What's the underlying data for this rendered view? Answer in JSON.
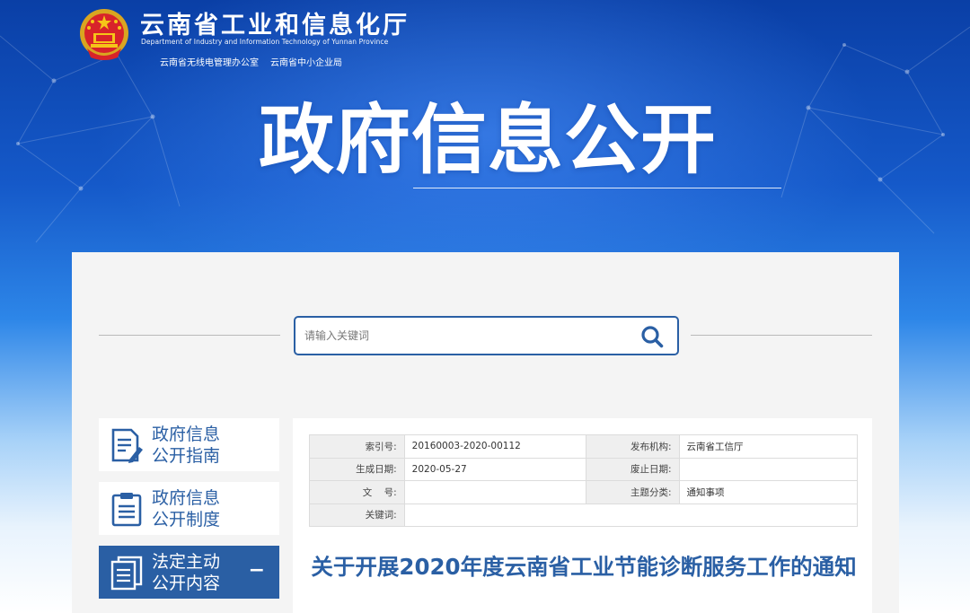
{
  "header": {
    "site_title": "云南省工业和信息化厅",
    "site_subtitle": "Department of Industry and Information Technology of Yunnan Province",
    "links": [
      {
        "label": "云南省无线电管理办公室"
      },
      {
        "label": "云南省中小企业局"
      }
    ],
    "hero_title": "政府信息公开"
  },
  "search": {
    "placeholder": "请输入关键词",
    "value": ""
  },
  "sidebar": {
    "items": [
      {
        "label_line1": "政府信息",
        "label_line2": "公开指南",
        "icon": "document-pen-icon",
        "active": false
      },
      {
        "label_line1": "政府信息",
        "label_line2": "公开制度",
        "icon": "clipboard-icon",
        "active": false
      },
      {
        "label_line1": "法定主动",
        "label_line2": "公开内容",
        "icon": "documents-icon",
        "active": true,
        "toggle": "−"
      }
    ]
  },
  "meta": {
    "rows": [
      {
        "k1": "索引号:",
        "v1": "20160003-2020-00112",
        "k2": "发布机构:",
        "v2": "云南省工信厅"
      },
      {
        "k1": "生成日期:",
        "v1": "2020-05-27",
        "k2": "废止日期:",
        "v2": ""
      },
      {
        "k1": "文    号:",
        "v1": "",
        "k2": "主题分类:",
        "v2": "通知事项"
      },
      {
        "k1": "关键词:",
        "v1": ""
      }
    ]
  },
  "document": {
    "title": "关于开展2020年度云南省工业节能诊断服务工作的通知"
  },
  "colors": {
    "brand_blue": "#2a5fa4",
    "banner_dark": "#0a3fa6",
    "panel_bg": "#f4f4f4"
  }
}
